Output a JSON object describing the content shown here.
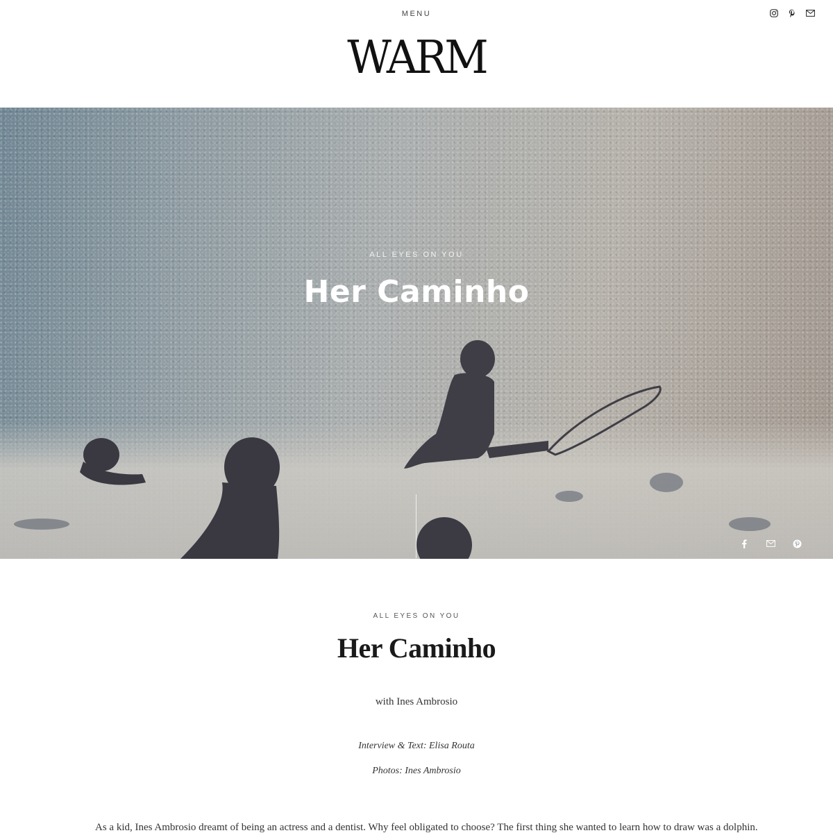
{
  "header": {
    "menu_label": "MENU",
    "logo_text": "WARM",
    "social_icons": [
      "instagram-icon",
      "pinterest-icon",
      "mail-icon"
    ]
  },
  "hero": {
    "kicker": "ALL EYES ON YOU",
    "title": "Her Caminho",
    "share_icons": [
      "facebook-icon",
      "mail-icon",
      "pinterest-icon"
    ]
  },
  "article": {
    "kicker": "ALL EYES ON YOU",
    "title": "Her Caminho",
    "subtitle": "with Ines Ambrosio",
    "credit_interview": "Interview & Text: Elisa Routa",
    "credit_photos": "Photos:  Ines Ambrosio",
    "intro": "As a kid, Ines Ambrosio dreamt of being an actress and a dentist. Why feel obligated to choose? The first thing she wanted to learn how to draw was a dolphin."
  }
}
